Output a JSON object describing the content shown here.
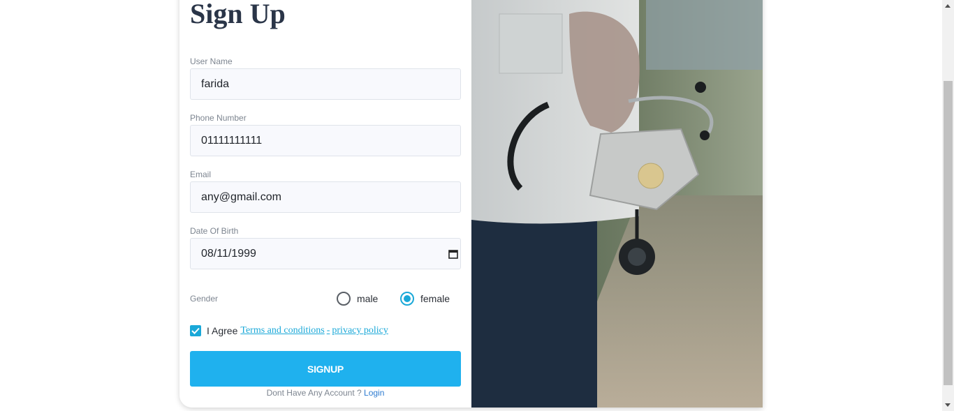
{
  "form": {
    "title": "Sign Up",
    "username": {
      "label": "User Name",
      "value": "farida"
    },
    "phone": {
      "label": "Phone Number",
      "value": "01111111111"
    },
    "email": {
      "label": "Email",
      "value": "any@gmail.com"
    },
    "dob": {
      "label": "Date Of Birth",
      "value": "08/11/1999"
    },
    "gender": {
      "label": "Gender",
      "options": [
        "male",
        "female"
      ],
      "selected": "female"
    },
    "agree": {
      "text": "I Agree",
      "terms_link": "Terms and conditions",
      "separator": "-",
      "privacy_link": "privacy policy",
      "checked": true
    },
    "submit_label": "SIGNUP",
    "footer": {
      "text": "Dont Have Any Account ?",
      "login_link": "Login"
    }
  },
  "colors": {
    "accent": "#1fb1ee",
    "radio_accent": "#1aa8d8",
    "title": "#2a3548",
    "label": "#7d8590",
    "input_bg": "#f8f9fd"
  },
  "image": {
    "subject": "doctor holding stethoscope and face mask"
  }
}
